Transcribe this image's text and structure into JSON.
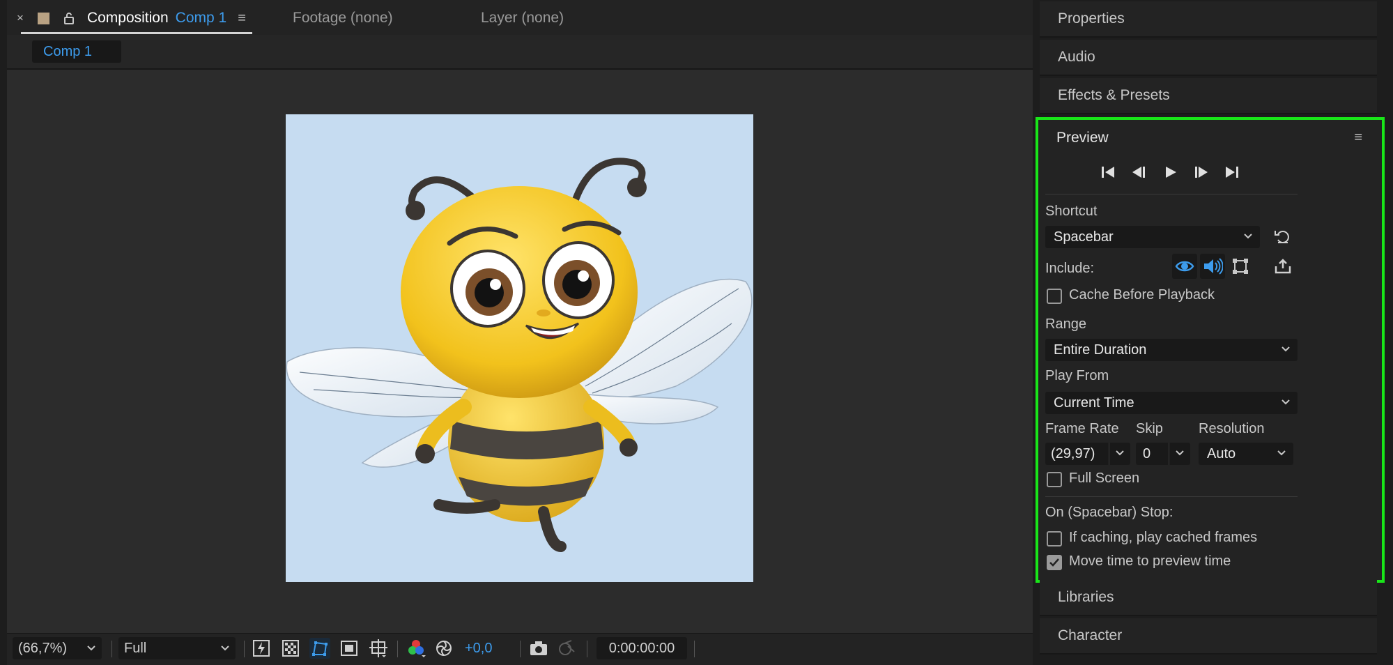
{
  "comp_tabs": {
    "close": "×",
    "composition_label": "Composition",
    "composition_name": "Comp 1",
    "menu": "≡",
    "footage": "Footage (none)",
    "layer": "Layer (none)"
  },
  "subtab": {
    "label": "Comp 1"
  },
  "viewer_bar": {
    "zoom": "(66,7%)",
    "resolution": "Full",
    "exposure": "+0,0",
    "timecode": "0:00:00:00"
  },
  "right_panels": {
    "properties": "Properties",
    "audio": "Audio",
    "effects_presets": "Effects & Presets",
    "libraries": "Libraries",
    "character": "Character"
  },
  "preview": {
    "title": "Preview",
    "menu": "≡",
    "shortcut_label": "Shortcut",
    "shortcut_value": "Spacebar",
    "include_label": "Include:",
    "cache_before_playback": "Cache Before Playback",
    "range_label": "Range",
    "range_value": "Entire Duration",
    "play_from_label": "Play From",
    "play_from_value": "Current Time",
    "frame_rate_label": "Frame Rate",
    "frame_rate_value": "(29,97)",
    "skip_label": "Skip",
    "skip_value": "0",
    "resolution_label": "Resolution",
    "resolution_value": "Auto",
    "full_screen": "Full Screen",
    "on_stop_label": "On (Spacebar) Stop:",
    "if_caching": "If caching, play cached frames",
    "move_time": "Move time to preview time",
    "states": {
      "cache_before_playback": false,
      "full_screen": false,
      "if_caching": false,
      "move_time": true,
      "include_video": true,
      "include_audio": true,
      "include_overlays": false
    }
  },
  "colors": {
    "accent_blue": "#3d9ced",
    "highlight_green": "#19e619",
    "panel_bg": "#232323"
  }
}
